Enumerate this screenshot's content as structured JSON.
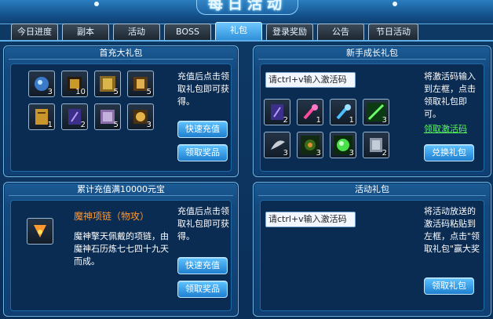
{
  "window": {
    "title": "每日活动"
  },
  "tabs": [
    {
      "label": "今日进度"
    },
    {
      "label": "副本"
    },
    {
      "label": "活动"
    },
    {
      "label": "BOSS"
    },
    {
      "label": "礼包",
      "active": true
    },
    {
      "label": "登录奖励"
    },
    {
      "label": "公告"
    },
    {
      "label": "节日活动"
    }
  ],
  "first_recharge": {
    "title": "首充大礼包",
    "items": [
      {
        "icon": "mount-orb-icon",
        "count": "3"
      },
      {
        "icon": "gold-token-icon",
        "count": "10"
      },
      {
        "icon": "gold-talisman-icon",
        "count": "5"
      },
      {
        "icon": "gold-seal-icon",
        "count": "5"
      },
      {
        "icon": "gold-scroll-icon",
        "count": "1"
      },
      {
        "icon": "purple-scroll-icon",
        "count": "2"
      },
      {
        "icon": "purple-book-icon",
        "count": "5"
      },
      {
        "icon": "gold-ingot-icon",
        "count": "3"
      }
    ],
    "description": "充值后点击领取礼包即可获得。",
    "recharge_button": "快速充值",
    "claim_button": "领取奖品"
  },
  "newbie": {
    "title": "新手成长礼包",
    "input_value": "请ctrl+v输入激活码",
    "items": [
      {
        "icon": "purple-scroll-icon",
        "count": "2"
      },
      {
        "icon": "red-potion-icon",
        "count": "1"
      },
      {
        "icon": "blue-potion-icon",
        "count": "1"
      },
      {
        "icon": "green-sword-icon",
        "count": "3"
      },
      {
        "icon": "feather-icon",
        "count": "3"
      },
      {
        "icon": "green-stone-icon",
        "count": "3"
      },
      {
        "icon": "green-orb-icon",
        "count": "3"
      },
      {
        "icon": "gray-card-icon",
        "count": "2"
      }
    ],
    "description": "将激活码输入到左框，点击领取礼包即可。",
    "get_code_link": "领取激活码",
    "redeem_button": "兑换礼包"
  },
  "cumulative": {
    "title": "累计充值满10000元宝",
    "item_name": "魔神项链（物攻）",
    "item_desc": "魔神擎天佩戴的项链，由魔神石历炼七七四十九天而成。",
    "description": "充值后点击领取礼包即可获得。",
    "recharge_button": "快速充值",
    "claim_button": "领取奖品"
  },
  "activity": {
    "title": "活动礼包",
    "input_value": "请ctrl+v输入激活码",
    "description": "将活动放送的激活码粘贴到左框，点击\"领取礼包\"赢大奖",
    "claim_button": "领取礼包"
  }
}
